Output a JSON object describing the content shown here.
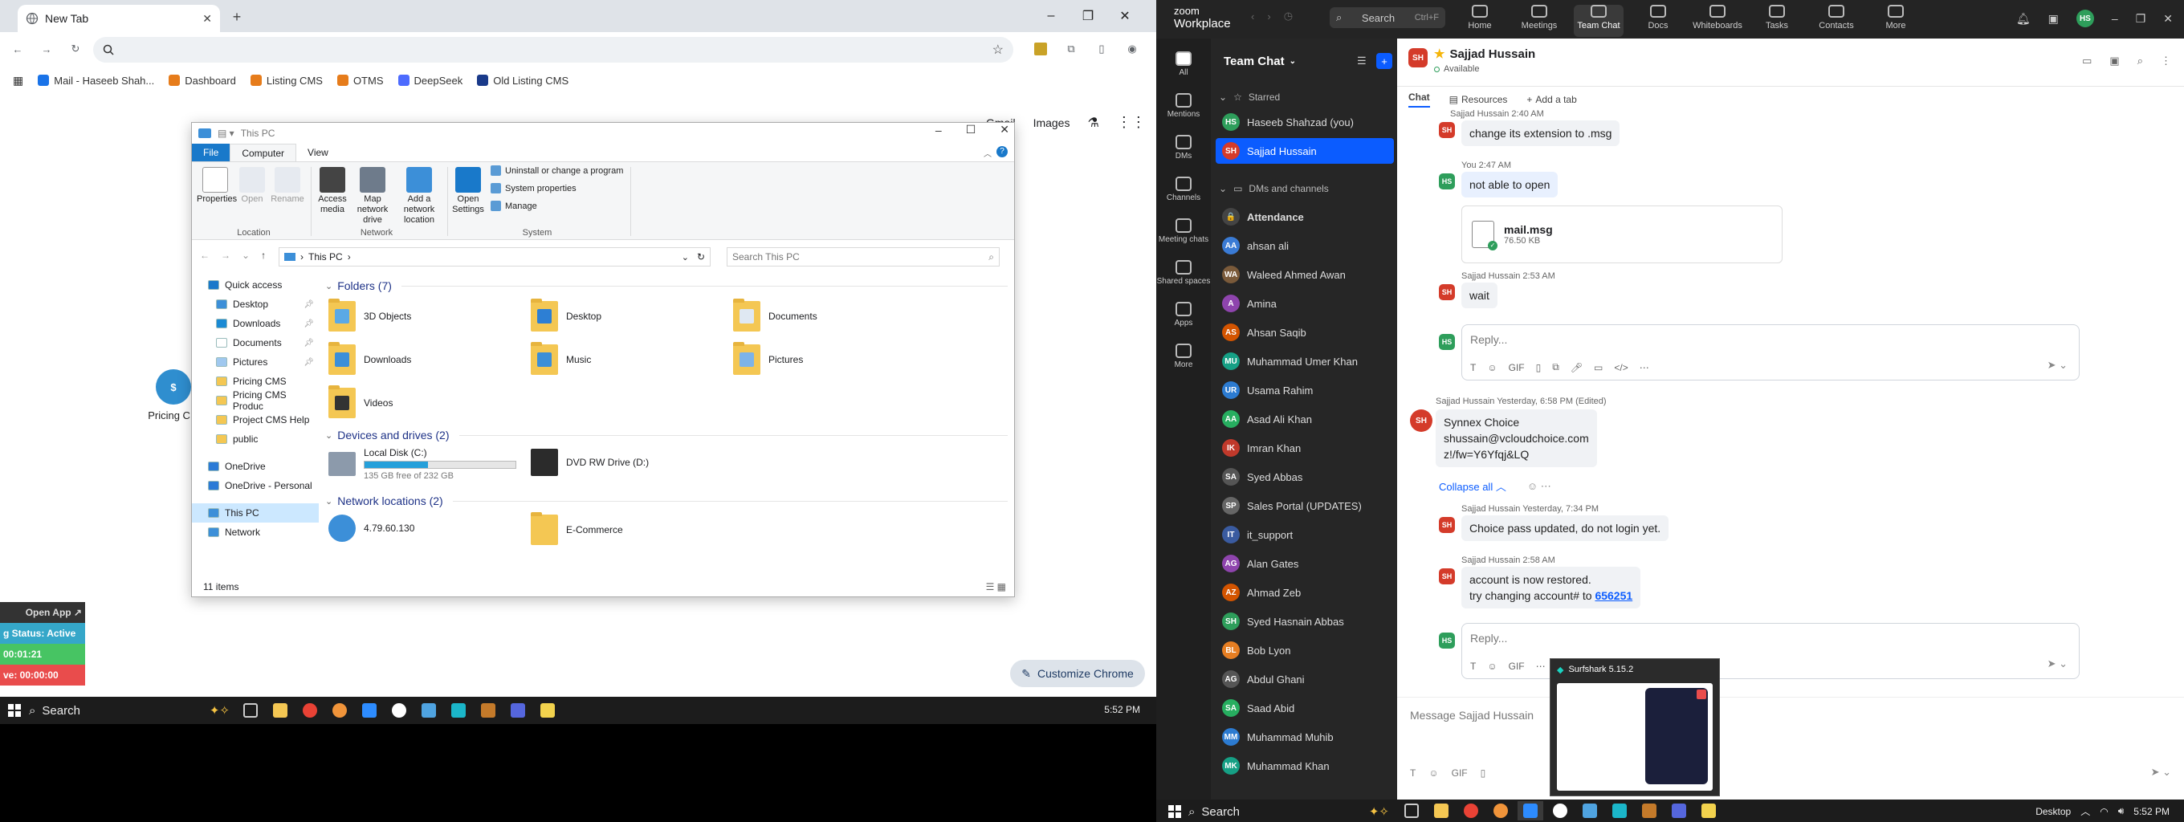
{
  "chrome": {
    "tab_title": "New Tab",
    "omnibox_value": "",
    "bookmarks": [
      {
        "label": "Mail - Haseeb Shah...",
        "color": "#1a73e8"
      },
      {
        "label": "Dashboard",
        "color": "#e67c1b"
      },
      {
        "label": "Listing CMS",
        "color": "#e67c1b"
      },
      {
        "label": "OTMS",
        "color": "#e67c1b"
      },
      {
        "label": "DeepSeek",
        "color": "#4d6bfe"
      },
      {
        "label": "Old Listing CMS",
        "color": "#1a3a8a"
      }
    ],
    "ntp": {
      "gmail": "Gmail",
      "images": "Images"
    },
    "customize_label": "Customize Chrome",
    "desktop_icon_label": "Pricing CM"
  },
  "explorer": {
    "title": "This PC",
    "tabs": [
      "File",
      "Computer",
      "View"
    ],
    "ribbon": {
      "properties": "Properties",
      "open": "Open",
      "rename": "Rename",
      "access_media": "Access media",
      "map_drive": "Map network drive",
      "add_location": "Add a network location",
      "open_settings": "Open Settings",
      "uninstall": "Uninstall or change a program",
      "system_properties": "System properties",
      "manage": "Manage",
      "group_location": "Location",
      "group_network": "Network",
      "group_system": "System"
    },
    "path": "This PC",
    "search_placeholder": "Search This PC",
    "nav": [
      {
        "label": "Quick access",
        "pin": false
      },
      {
        "label": "Desktop",
        "pin": true
      },
      {
        "label": "Downloads",
        "pin": true
      },
      {
        "label": "Documents",
        "pin": true
      },
      {
        "label": "Pictures",
        "pin": true
      },
      {
        "label": "Pricing CMS",
        "pin": false
      },
      {
        "label": "Pricing CMS Produc",
        "pin": false
      },
      {
        "label": "Project CMS Help",
        "pin": false
      },
      {
        "label": "public",
        "pin": false
      },
      {
        "label": "OneDrive",
        "pin": false
      },
      {
        "label": "OneDrive - Personal",
        "pin": false
      },
      {
        "label": "This PC",
        "pin": false
      },
      {
        "label": "Network",
        "pin": false
      }
    ],
    "sections": {
      "folders": "Folders (7)",
      "devices": "Devices and drives (2)",
      "network": "Network locations (2)"
    },
    "folders": [
      "3D Objects",
      "Desktop",
      "Documents",
      "Downloads",
      "Music",
      "Pictures",
      "Videos"
    ],
    "drives": {
      "c_label": "Local Disk (C:)",
      "c_free": "135 GB free of 232 GB",
      "c_used_fraction": 0.42,
      "d_label": "DVD RW Drive (D:)"
    },
    "network_locations": [
      "4.79.60.130",
      "E-Commerce"
    ],
    "status": "11 items"
  },
  "tracker": {
    "open_app": "Open App ↗",
    "status": "g Status: Active",
    "time1": "00:01:21",
    "time2": "ve: 00:00:00"
  },
  "taskbar_left": {
    "search": "Search",
    "time": "5:52 PM"
  },
  "zoom": {
    "brand_top": "zoom",
    "brand_bottom": "Workplace",
    "search": "Search",
    "search_shortcut": "Ctrl+F",
    "nav": [
      "Home",
      "Meetings",
      "Team Chat",
      "Docs",
      "Whiteboards",
      "Tasks",
      "Contacts",
      "More"
    ],
    "rail": [
      "All",
      "Mentions",
      "DMs",
      "Channels",
      "Meeting chats",
      "Shared spaces",
      "Apps",
      "More"
    ],
    "list_title": "Team Chat",
    "starred_header": "Starred",
    "dm_header": "DMs and channels",
    "starred": [
      {
        "name": "Haseeb Shahzad (you)",
        "initials": "HS",
        "color": "#2e9e5b"
      },
      {
        "name": "Sajjad Hussain",
        "initials": "SH",
        "color": "#d43b2a"
      }
    ],
    "contacts": [
      {
        "name": "Attendance",
        "initials": "🔒",
        "color": "#444"
      },
      {
        "name": "ahsan ali",
        "initials": "AA",
        "color": "#3a7bd5"
      },
      {
        "name": "Waleed Ahmed Awan",
        "initials": "WA",
        "color": "#7a5a3a"
      },
      {
        "name": "Amina",
        "initials": "A",
        "color": "#8e44ad"
      },
      {
        "name": "Ahsan Saqib",
        "initials": "AS",
        "color": "#d35400"
      },
      {
        "name": "Muhammad Umer Khan",
        "initials": "MU",
        "color": "#16a085"
      },
      {
        "name": "Usama Rahim",
        "initials": "UR",
        "color": "#2c7bd1"
      },
      {
        "name": "Asad Ali Khan",
        "initials": "AA",
        "color": "#27ae60"
      },
      {
        "name": "Imran Khan",
        "initials": "IK",
        "color": "#c0392b"
      },
      {
        "name": "Syed Abbas",
        "initials": "SA",
        "color": "#555"
      },
      {
        "name": "Sales Portal (UPDATES)",
        "initials": "SP",
        "color": "#666"
      },
      {
        "name": "it_support",
        "initials": "IT",
        "color": "#3a5ba0"
      },
      {
        "name": "Alan Gates",
        "initials": "AG",
        "color": "#8e44ad"
      },
      {
        "name": "Ahmad Zeb",
        "initials": "AZ",
        "color": "#d35400"
      },
      {
        "name": "Syed Hasnain Abbas",
        "initials": "SH",
        "color": "#2e9e5b"
      },
      {
        "name": "Bob Lyon",
        "initials": "BL",
        "color": "#e67e22"
      },
      {
        "name": "Abdul Ghani",
        "initials": "AG",
        "color": "#555"
      },
      {
        "name": "Saad Abid",
        "initials": "SA",
        "color": "#27ae60"
      },
      {
        "name": "Muhammad Muhib",
        "initials": "MM",
        "color": "#2c7bd1"
      },
      {
        "name": "Muhammad Khan",
        "initials": "MK",
        "color": "#16a085"
      }
    ],
    "chat_name": "Sajjad Hussain",
    "chat_status": "Available",
    "chat_tabs": [
      "Chat",
      "Resources",
      "Add a tab"
    ],
    "messages": {
      "m1_meta": "Sajjad Hussain 2:40 AM",
      "m1_text": "change its extension to .msg",
      "m2_meta": "You 2:47 AM",
      "m2_text": "not able to open",
      "file_name": "mail.msg",
      "file_size": "76.50 KB",
      "m3_meta": "Sajjad Hussain 2:53 AM",
      "m3_text": "wait",
      "thread_meta": "Sajjad Hussain Yesterday, 6:58 PM (Edited)",
      "thread_l1": "Synnex Choice",
      "thread_l2": "shussain@vcloudchoice.com",
      "thread_l3": "z!/fw=Y6Yfqj&LQ",
      "collapse": "Collapse all",
      "m4_meta": "Sajjad Hussain Yesterday, 7:34 PM",
      "m4_text": "Choice pass updated, do not login yet.",
      "m5_meta": "Sajjad Hussain 2:58 AM",
      "m5_l1": "account is now restored.",
      "m5_l2": "try changing account# to",
      "m5_link": "656251"
    },
    "reply_placeholder": "Reply...",
    "compose_placeholder": "Message Sajjad Hussain",
    "surfshark_title": "Surfshark 5.15.2"
  },
  "taskbar_right": {
    "search": "Search",
    "desktop": "Desktop",
    "time": "5:52 PM"
  }
}
